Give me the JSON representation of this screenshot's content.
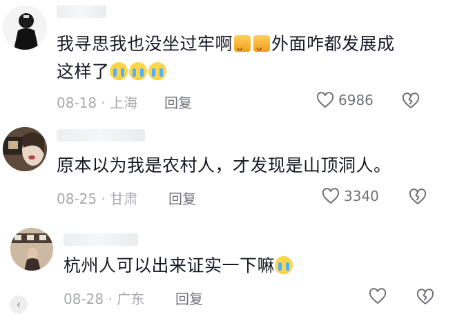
{
  "comments": [
    {
      "text_part1": "我寻思我也没坐过牢啊",
      "text_part2": "外面咋都发展成",
      "text_line2": "这样了",
      "date": "08-18",
      "location": "上海",
      "reply_label": "回复",
      "likes": "6986"
    },
    {
      "text": "原本以为我是农村人，才发现是山顶洞人。",
      "date": "08-25",
      "location": "甘肃",
      "reply_label": "回复",
      "likes": "3340"
    },
    {
      "text": "杭州人可以出来证实一下嘛",
      "date": "08-28",
      "location": "广东",
      "reply_label": "回复",
      "likes": ""
    }
  ],
  "separator": "·"
}
